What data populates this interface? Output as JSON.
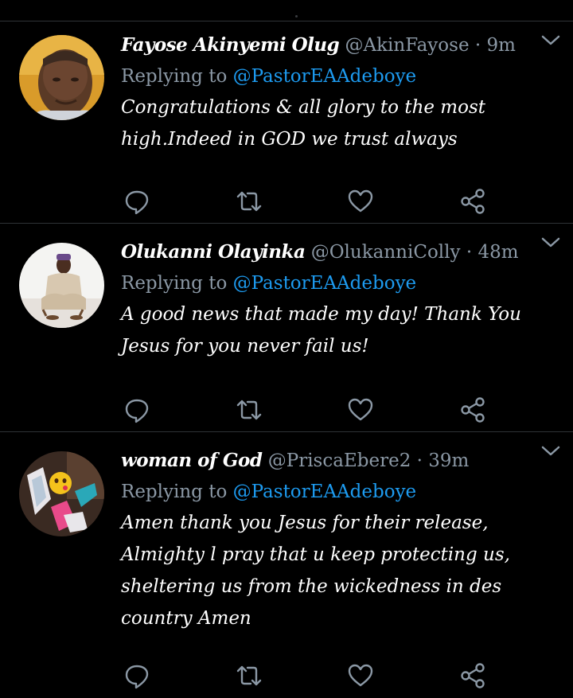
{
  "tweets": [
    {
      "name": "Fayose Akinyemi Olug",
      "handle": "@AkinFayose",
      "separator": "·",
      "time": "9m",
      "replying_label": "Replying to",
      "replying_to": "@PastorEAAdeboye",
      "body": "Congratulations & all glory to the most high.Indeed in GOD we trust always"
    },
    {
      "name": "Olukanni Olayinka",
      "handle": "@OlukanniColly",
      "separator": "·",
      "time": "48m",
      "replying_label": "Replying to",
      "replying_to": "@PastorEAAdeboye",
      "body": "A good news that made my day! Thank You Jesus for you never fail us!"
    },
    {
      "name": "woman of God",
      "handle": "@PriscaEbere2",
      "separator": "·",
      "time": "39m",
      "replying_label": "Replying to",
      "replying_to": "@PastorEAAdeboye",
      "body": "Amen thank you Jesus for their release, Almighty l pray that u keep protecting us, sheltering us from the wickedness in des country Amen"
    }
  ],
  "icons": {
    "reply": "reply-icon",
    "retweet": "retweet-icon",
    "like": "like-icon",
    "share": "share-icon",
    "more": "chevron-down-icon"
  },
  "colors": {
    "background": "#000000",
    "mention": "#1d9bf0",
    "muted": "#8b98a5",
    "divider": "#2f3336"
  }
}
